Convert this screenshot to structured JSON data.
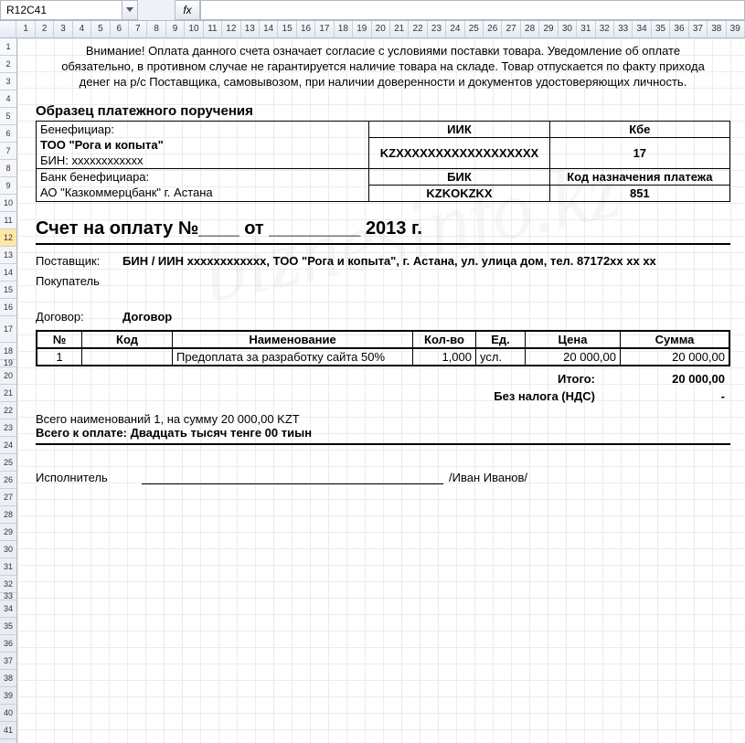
{
  "namebox": "R12C41",
  "fx": "fx",
  "formula": "",
  "cols": [
    "1",
    "2",
    "3",
    "4",
    "5",
    "6",
    "7",
    "8",
    "9",
    "10",
    "11",
    "12",
    "13",
    "14",
    "15",
    "16",
    "17",
    "18",
    "19",
    "20",
    "21",
    "22",
    "23",
    "24",
    "25",
    "26",
    "27",
    "28",
    "29",
    "30",
    "31",
    "32",
    "33",
    "34",
    "35",
    "36",
    "37",
    "38",
    "39"
  ],
  "rows": [
    "1",
    "2",
    "3",
    "4",
    "5",
    "6",
    "7",
    "8",
    "9",
    "10",
    "11",
    "12",
    "13",
    "14",
    "15",
    "16",
    "17",
    "18",
    "19",
    "20",
    "21",
    "22",
    "23",
    "24",
    "25",
    "26",
    "27",
    "28",
    "29",
    "30",
    "31",
    "32",
    "33",
    "34",
    "35",
    "36",
    "37",
    "38",
    "39",
    "40",
    "41"
  ],
  "selRow": "12",
  "warn": {
    "l1": "Внимание! Оплата данного счета означает согласие с условиями поставки товара. Уведомление об оплате",
    "l2": "обязательно, в противном случае не гарантируется наличие товара на складе. Товар отпускается по факту  прихода денег на р/с Поставщика, самовывозом, при наличии доверенности и документов удостоверяющих личность."
  },
  "sample": "Образец платежного поручения",
  "bene": {
    "benef_label": "Бенефициар:",
    "benef_name": "ТОО \"Рога и копыта\"",
    "bin": "БИН: xxxxxxxxxxxx",
    "iik_label": "ИИК",
    "iik": "KZXXXXXXXXXXXXXXXXXX",
    "kbe_label": "Кбе",
    "kbe": "17",
    "bank_label": "Банк бенефициара:",
    "bank": "АО \"Казкоммерцбанк\" г. Астана",
    "bik_label": "БИК",
    "bik": "KZKOKZKX",
    "code_label": "Код назначения платежа",
    "code": "851"
  },
  "title": "Счет на оплату №____  от  _________  2013 г.",
  "supplier": {
    "lbl": "Поставщик:",
    "val": "БИН / ИИН xxxxxxxxxxxx, ТОО \"Рога и копыта\", г. Астана, ул. улица дом, тел. 87172xx xx xx"
  },
  "buyer": {
    "lbl": "Покупатель",
    "val": ""
  },
  "contract": {
    "lbl": "Договор:",
    "val": "Договор"
  },
  "table": {
    "head": {
      "n": "№",
      "code": "Код",
      "name": "Наименование",
      "qty": "Кол-во",
      "unit": "Ед.",
      "price": "Цена",
      "sum": "Сумма"
    },
    "rows": [
      {
        "n": "1",
        "code": "",
        "name": "Предоплата за разработку сайта 50%",
        "qty": "1,000",
        "unit": "усл.",
        "price": "20 000,00",
        "sum": "20 000,00"
      }
    ]
  },
  "totals": {
    "itogo_lbl": "Итого:",
    "itogo": "20 000,00",
    "nds_lbl": "Без налога (НДС)",
    "nds": "-"
  },
  "summary": {
    "l1": "Всего наименований 1, на сумму 20 000,00 KZT",
    "l2_a": "Всего к оплате: ",
    "l2_b": "Двадцать тысяч тенге 00 тиын"
  },
  "exec": {
    "lbl": "Исполнитель",
    "who": "/Иван Иванов/"
  },
  "wm": "biznesinfo.kz"
}
